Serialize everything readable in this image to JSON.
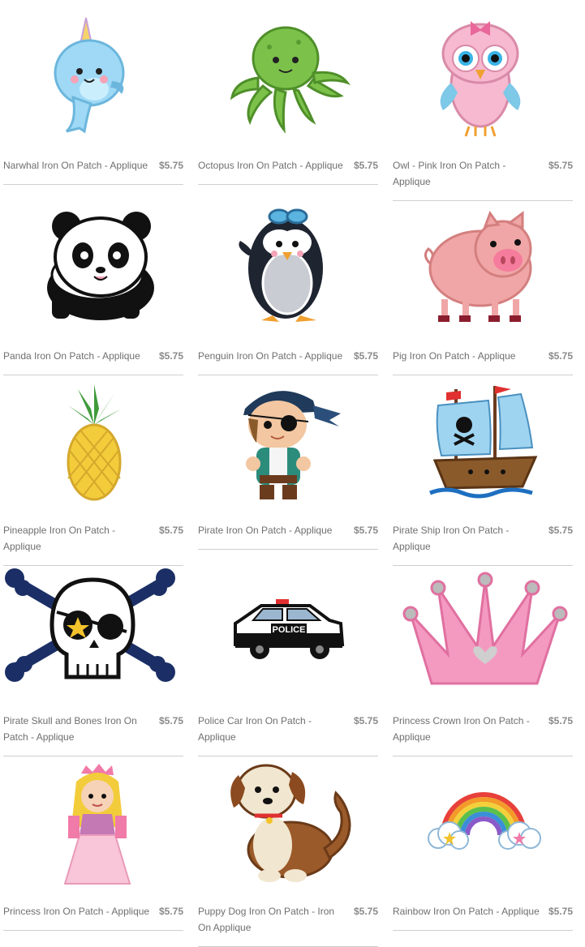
{
  "products": [
    {
      "name": "Narwhal Iron On Patch - Applique",
      "price": "$5.75",
      "icon": "narwhal-icon"
    },
    {
      "name": "Octopus Iron On Patch - Applique",
      "price": "$5.75",
      "icon": "octopus-icon"
    },
    {
      "name": "Owl - Pink Iron On Patch - Applique",
      "price": "$5.75",
      "icon": "owl-icon"
    },
    {
      "name": "Panda Iron On Patch - Applique",
      "price": "$5.75",
      "icon": "panda-icon"
    },
    {
      "name": "Penguin Iron On Patch - Applique",
      "price": "$5.75",
      "icon": "penguin-icon"
    },
    {
      "name": "Pig Iron On Patch - Applique",
      "price": "$5.75",
      "icon": "pig-icon"
    },
    {
      "name": "Pineapple Iron On Patch - Applique",
      "price": "$5.75",
      "icon": "pineapple-icon"
    },
    {
      "name": "Pirate Iron On Patch - Applique",
      "price": "$5.75",
      "icon": "pirate-icon"
    },
    {
      "name": "Pirate Ship Iron On Patch - Applique",
      "price": "$5.75",
      "icon": "pirate-ship-icon"
    },
    {
      "name": "Pirate Skull and Bones Iron On Patch - Applique",
      "price": "$5.75",
      "icon": "skull-icon"
    },
    {
      "name": "Police Car Iron On Patch - Applique",
      "price": "$5.75",
      "icon": "police-car-icon"
    },
    {
      "name": "Princess Crown Iron On Patch - Applique",
      "price": "$5.75",
      "icon": "crown-icon"
    },
    {
      "name": "Princess Iron On Patch - Applique",
      "price": "$5.75",
      "icon": "princess-icon"
    },
    {
      "name": "Puppy Dog Iron On Patch - Iron On Applique",
      "price": "$5.75",
      "icon": "puppy-icon"
    },
    {
      "name": "Rainbow Iron On Patch - Applique",
      "price": "$5.75",
      "icon": "rainbow-icon"
    }
  ],
  "police_label": "POLICE"
}
